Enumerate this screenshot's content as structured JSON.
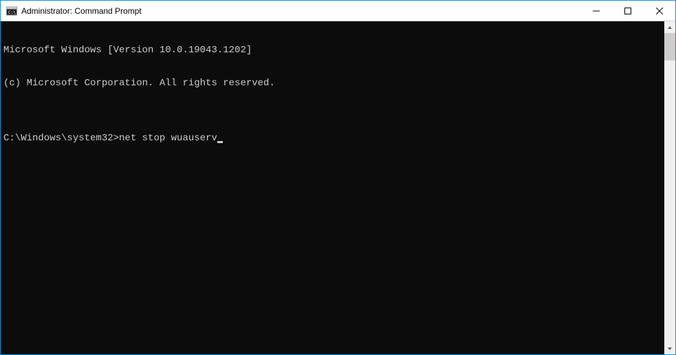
{
  "window": {
    "title": "Administrator: Command Prompt"
  },
  "terminal": {
    "line1": "Microsoft Windows [Version 10.0.19043.1202]",
    "line2": "(c) Microsoft Corporation. All rights reserved.",
    "blank": "",
    "prompt": "C:\\Windows\\system32>",
    "command": "net stop wuauserv"
  }
}
